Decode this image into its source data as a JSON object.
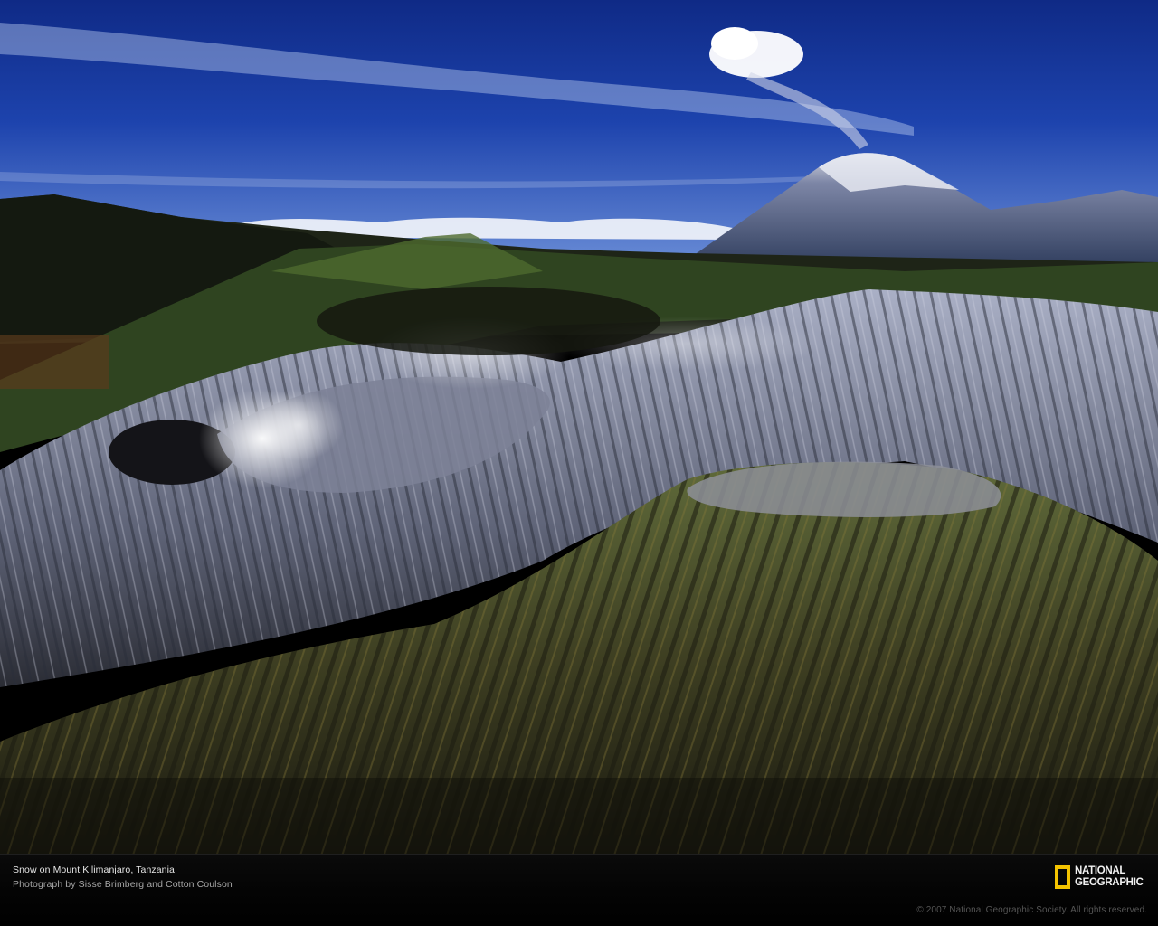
{
  "photo": {
    "subject": "volcanic-landscape-photo"
  },
  "caption": {
    "title": "Snow on Mount Kilimanjaro, Tanzania",
    "credit": "Photograph by Sisse Brimberg and Cotton Coulson"
  },
  "logo": {
    "line1": "NATIONAL",
    "line2": "GEOGRAPHIC",
    "frame_color": "#f3c300"
  },
  "copyright": "© 2007 National Geographic Society. All rights reserved."
}
